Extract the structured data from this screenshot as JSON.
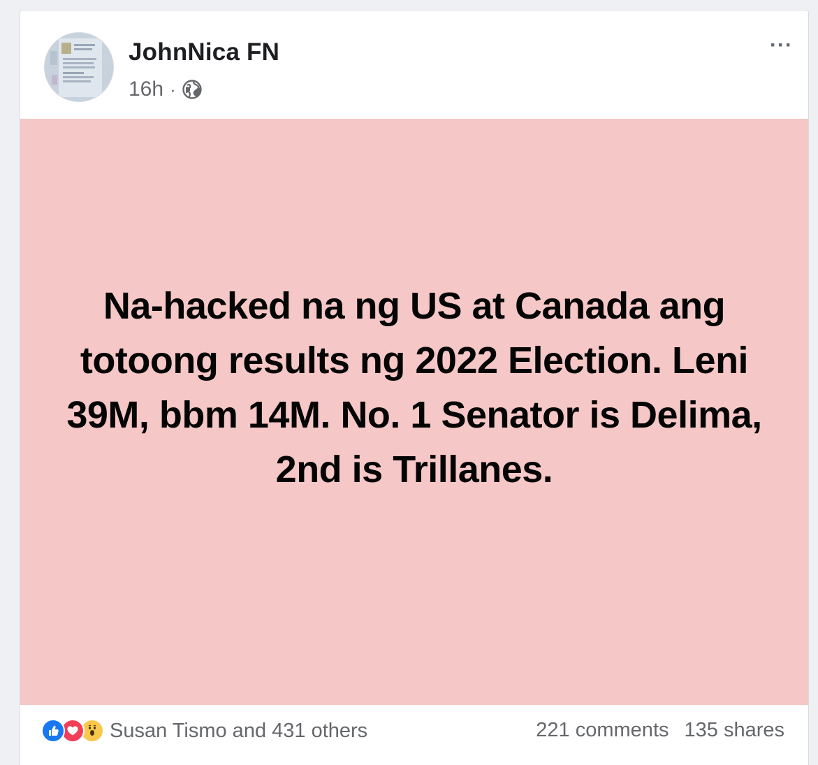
{
  "post": {
    "author": "JohnNica FN",
    "timestamp": "16h",
    "separator": "·",
    "audience_icon": "globe-icon",
    "more_label": "···",
    "background_color": "#f5c7c6",
    "body_text": "Na-hacked na ng US at Canada ang totoong results ng 2022 Election. Leni 39M, bbm 14M. No. 1 Senator is Delima, 2nd is Trillanes."
  },
  "footer": {
    "reaction_icons": [
      "like-icon",
      "love-icon",
      "wow-icon"
    ],
    "reactions_text": "Susan Tismo and 431 others",
    "comments": "221 comments",
    "shares": "135 shares"
  },
  "colors": {
    "like": "#1877f2",
    "love": "#f33e58",
    "wow": "#f7c84b",
    "secondary_text": "#65676b"
  }
}
